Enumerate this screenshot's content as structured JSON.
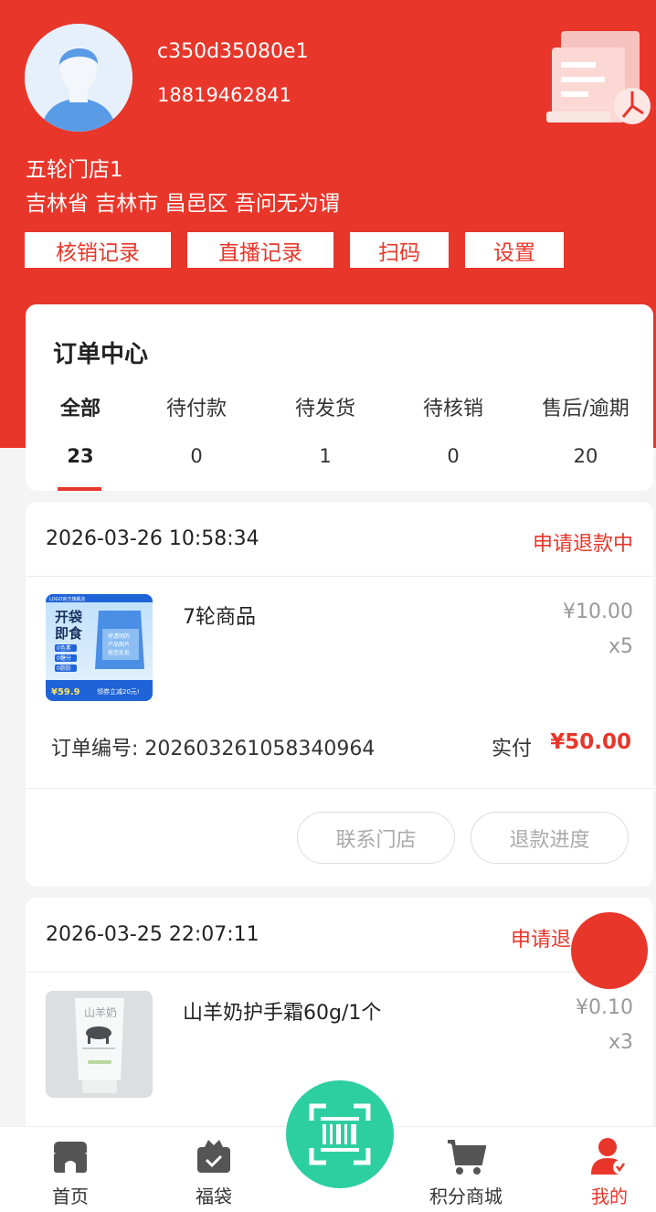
{
  "user": {
    "id": "c350d35080e1",
    "phone": "18819462841",
    "store_name": "五轮门店1",
    "address": "吉林省 吉林市 昌邑区 吾问无为谓"
  },
  "header_buttons": [
    "核销记录",
    "直播记录",
    "扫码",
    "设置"
  ],
  "order_center": {
    "title": "订单中心",
    "tabs": [
      {
        "label": "全部",
        "count": "23"
      },
      {
        "label": "待付款",
        "count": "0"
      },
      {
        "label": "待发货",
        "count": "1"
      },
      {
        "label": "待核销",
        "count": "0"
      },
      {
        "label": "售后/逾期",
        "count": "20"
      }
    ]
  },
  "orders": [
    {
      "time": "2026-03-26 10:58:34",
      "status": "申请退款中",
      "product_name": "7轮商品",
      "price": "¥10.00",
      "qty": "x5",
      "order_no": "订单编号: 202603261058340964",
      "paid_label": "实付",
      "paid": "¥50.00",
      "actions": [
        "联系门店",
        "退款进度"
      ],
      "thumb": {
        "top_tag": "LOGO官方旗舰店",
        "headline_1": "开袋",
        "headline_2": "即食",
        "tags": [
          "0色素",
          "0糖分",
          "0脂肪"
        ],
        "bag_text_1": "将透明的",
        "bag_text_2": "产品图片",
        "bag_text_3": "拖至此处",
        "price": "¥59.9",
        "coupon": "领券立减20元!"
      }
    },
    {
      "time": "2026-03-25 22:07:11",
      "status": "申请退",
      "product_name": "山羊奶护手霜60g/1个",
      "price": "¥0.10",
      "qty": "x3",
      "thumb": {
        "brand": "山羊奶"
      }
    }
  ],
  "bottom_nav": [
    {
      "label": "首页",
      "icon": "store-icon"
    },
    {
      "label": "福袋",
      "icon": "gift-bag-icon"
    },
    {
      "label": "积分商城",
      "icon": "cart-icon"
    },
    {
      "label": "我的",
      "icon": "user-icon"
    }
  ],
  "colors": {
    "primary": "#e8362a",
    "scan": "#2dcfa1"
  }
}
